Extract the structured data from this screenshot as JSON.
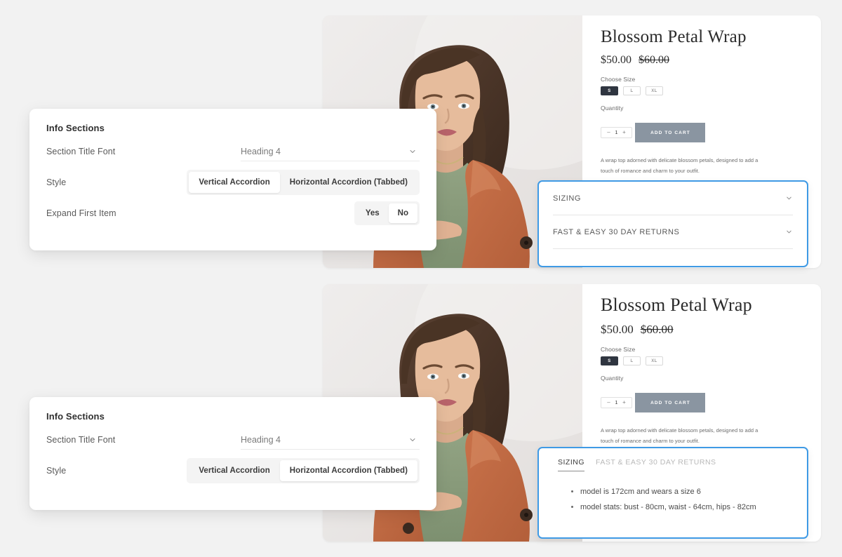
{
  "background_color": "#f2f2f2",
  "accent_color": "#3f9ae5",
  "button_color": "#8a95a1",
  "product": {
    "title": "Blossom Petal Wrap",
    "price": "$50.00",
    "compare_at_price": "$60.00",
    "size_label": "Choose Size",
    "sizes": [
      {
        "label": "S",
        "selected": true
      },
      {
        "label": "L",
        "selected": false
      },
      {
        "label": "XL",
        "selected": false
      }
    ],
    "quantity_label": "Quantity",
    "quantity_minus": "–",
    "quantity_value": "1",
    "quantity_plus": "+",
    "add_to_cart_label": "ADD TO CART",
    "description": "A wrap top adorned with delicate blossom petals, designed to add a touch of romance and charm to your outfit."
  },
  "vertical_accordion": {
    "items": [
      {
        "title": "SIZING"
      },
      {
        "title": "FAST & EASY 30 DAY RETURNS"
      }
    ]
  },
  "tabbed_accordion": {
    "tabs": [
      {
        "label": "SIZING",
        "active": true
      },
      {
        "label": "FAST & EASY 30 DAY RETURNS",
        "active": false
      }
    ],
    "content": [
      "model is 172cm and wears a size 6",
      "model stats: bust - 80cm, waist - 64cm, hips - 82cm"
    ]
  },
  "settings_panel_one": {
    "title": "Info Sections",
    "section_title_font": {
      "label": "Section Title Font",
      "value": "Heading 4",
      "icon": "chevron-down-icon"
    },
    "style": {
      "label": "Style",
      "options": [
        {
          "label": "Vertical Accordion",
          "active": true
        },
        {
          "label": "Horizontal Accordion (Tabbed)",
          "active": false
        }
      ]
    },
    "expand_first_item": {
      "label": "Expand First Item",
      "options": [
        {
          "label": "Yes",
          "active": false
        },
        {
          "label": "No",
          "active": true
        }
      ]
    }
  },
  "settings_panel_two": {
    "title": "Info Sections",
    "section_title_font": {
      "label": "Section Title Font",
      "value": "Heading 4",
      "icon": "chevron-down-icon"
    },
    "style": {
      "label": "Style",
      "options": [
        {
          "label": "Vertical Accordion",
          "active": false
        },
        {
          "label": "Horizontal Accordion (Tabbed)",
          "active": true
        }
      ]
    }
  }
}
